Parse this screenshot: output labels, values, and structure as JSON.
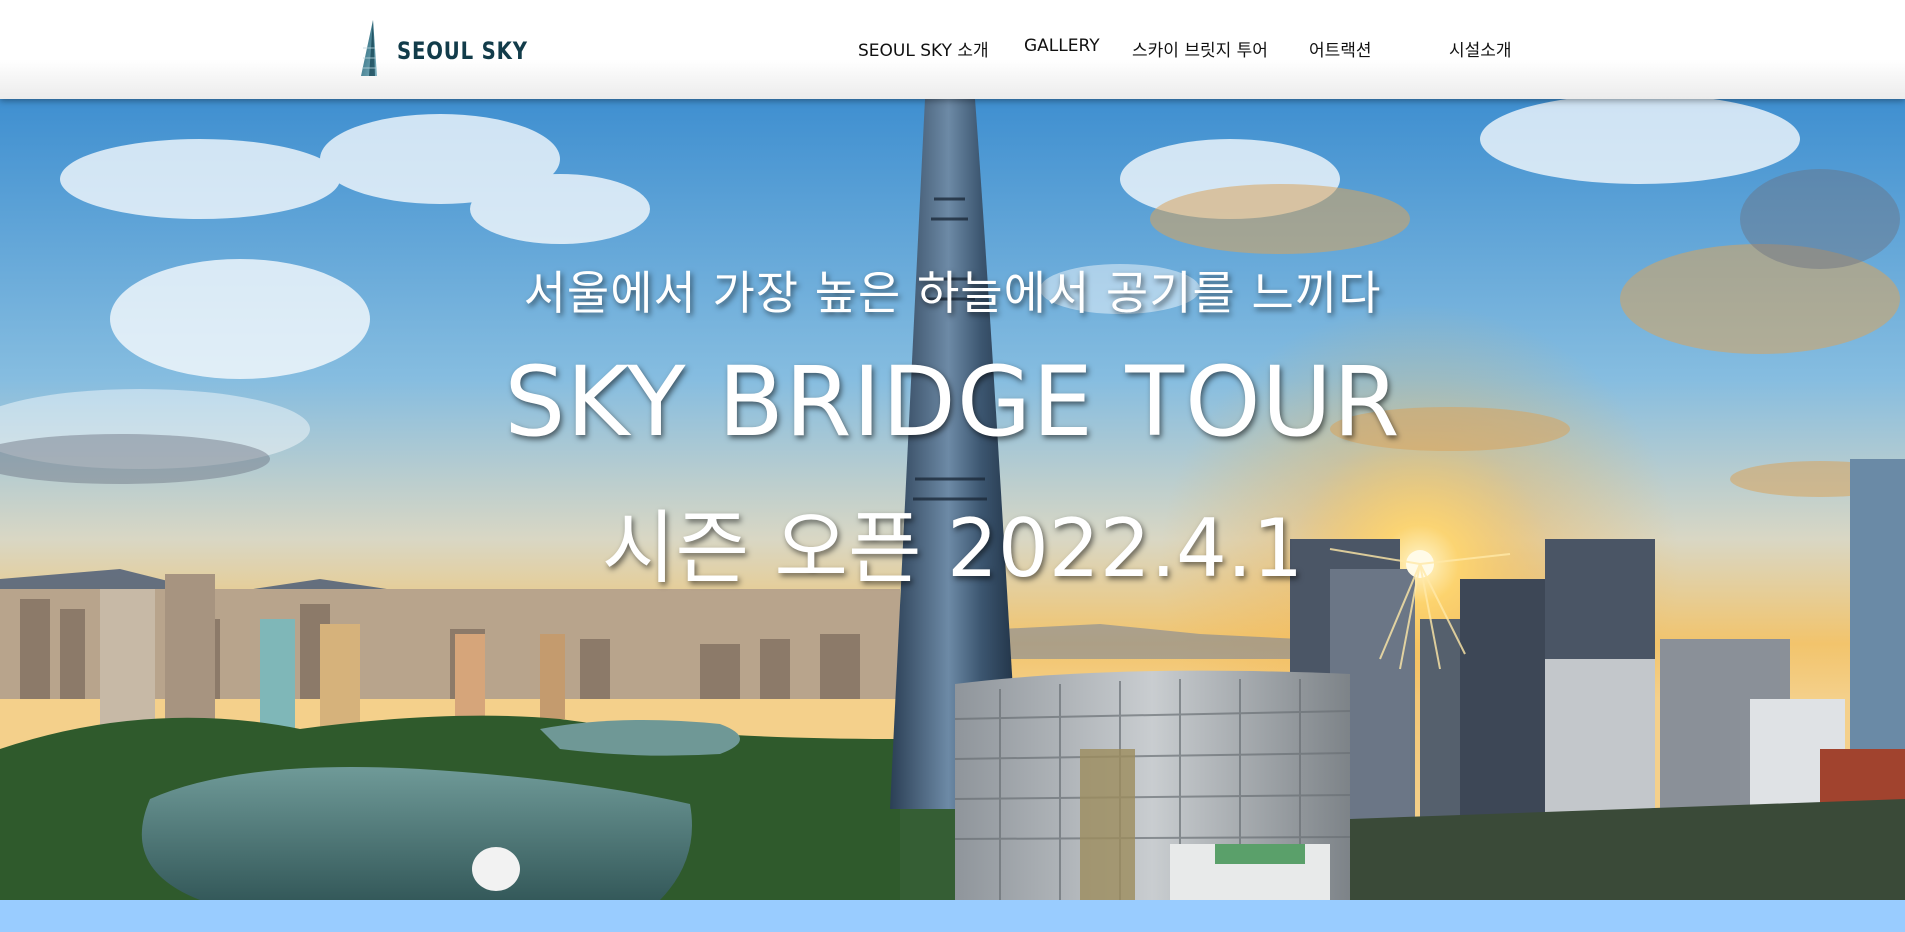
{
  "header": {
    "logo_text": "SEOUL SKY",
    "nav": [
      {
        "label": "SEOUL SKY 소개"
      },
      {
        "label": "GALLERY"
      },
      {
        "label": "스카이 브릿지 투어"
      },
      {
        "label": "어트랙션"
      },
      {
        "label": "시설소개"
      }
    ]
  },
  "hero": {
    "subtitle": "서울에서 가장 높은 하늘에서 공기를 느끼다",
    "title": "SKY BRIDGE TOUR",
    "date_line": "시즌 오픈 2022.4.1",
    "image_icon": "seoul-skyline-photo"
  },
  "colors": {
    "logo": "#123c4a",
    "nav_text": "#111111",
    "hero_text": "#ffffff",
    "bottom_band": "#99ccff",
    "sky_top": "#4a9bd6",
    "sky_horizon": "#f5c66a"
  }
}
